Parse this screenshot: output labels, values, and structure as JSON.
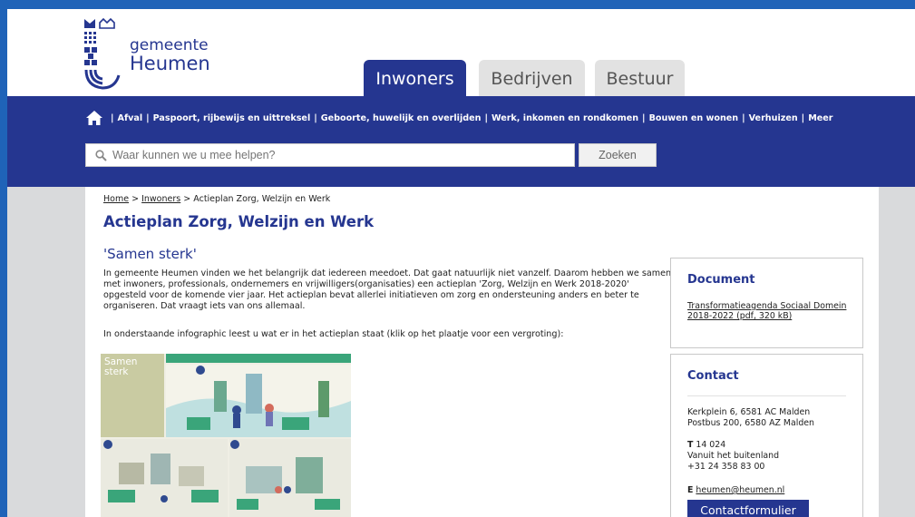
{
  "header": {
    "logo_line1": "gemeente",
    "logo_line2": "Heumen",
    "tabs": [
      {
        "label": "Inwoners",
        "active": true
      },
      {
        "label": "Bedrijven",
        "active": false
      },
      {
        "label": "Bestuur",
        "active": false
      }
    ]
  },
  "nav": {
    "home_icon": "home-icon",
    "links": [
      "Afval",
      "Paspoort, rijbewijs en uittreksel",
      "Geboorte, huwelijk en overlijden",
      "Werk, inkomen en rondkomen",
      "Bouwen en wonen",
      "Verhuizen",
      "Meer"
    ],
    "separator": "|"
  },
  "search": {
    "placeholder": "Waar kunnen we u mee helpen?",
    "button_label": "Zoeken"
  },
  "breadcrumb": {
    "home": "Home",
    "sep1": ">",
    "inwoners": "Inwoners",
    "sep2": ">",
    "current": "Actieplan Zorg, Welzijn en Werk"
  },
  "main": {
    "title": "Actieplan Zorg, Welzijn en Werk",
    "subtitle": "'Samen sterk'",
    "paragraph": "In gemeente Heumen vinden we het belangrijk dat iedereen meedoet. Dat gaat natuurlijk niet vanzelf. Daarom hebben we samen met inwoners, professionals, ondernemers en vrijwilligers(organisaties) een actieplan 'Zorg, Welzijn en Werk 2018-2020' opgesteld voor de komende vier jaar. Het actieplan bevat allerlei initiatieven om zorg en ondersteuning anders en beter te organiseren. Dat vraagt iets van ons allemaal.",
    "paragraph2": "In onderstaande infographic leest u wat er in het actieplan staat (klik op het plaatje voor een vergroting):",
    "infographic_title": "Samen sterk"
  },
  "sidebar": {
    "document": {
      "title": "Document",
      "link": "Transformatieagenda Sociaal Domein 2018-2022 (pdf, 320 kB)"
    },
    "contact": {
      "title": "Contact",
      "address1": "Kerkplein 6, 6581 AC Malden",
      "address2": "Postbus 200, 6580 AZ Malden",
      "phone_label": "T",
      "phone": "14 024",
      "abroad_label": "Vanuit het buitenland",
      "abroad_phone": "+31 24 358 83 00",
      "email_label": "E",
      "email": "heumen@heumen.nl",
      "form_button": "Contactformulier"
    }
  },
  "colors": {
    "brand_blue": "#253690",
    "accent_blue": "#1f63b8"
  }
}
